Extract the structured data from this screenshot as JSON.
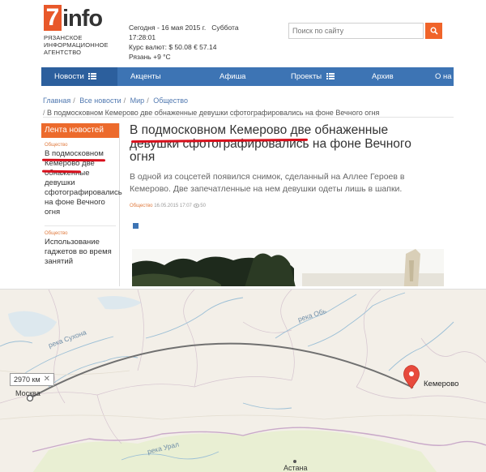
{
  "site": {
    "logo_digit": "7",
    "logo_word": "info",
    "agency_lines": [
      "РЯЗАНСКОЕ",
      "ИНФОРМАЦИОННОЕ",
      "АГЕНТСТВО"
    ],
    "date_line": "Сегодня - 16 мая 2015 г.   Суббота",
    "time_line": "17:28:01",
    "rates_line": "Курс валют: $ 50.08 € 57.14",
    "weather_line": "Рязань +9 °C",
    "search": {
      "placeholder": "Поиск по сайту",
      "icon": "search-icon"
    },
    "nav": [
      {
        "label": "Новости",
        "icon": "menu-bars-icon",
        "active": true
      },
      {
        "label": "Акценты"
      },
      {
        "label": "Афиша"
      },
      {
        "label": "Проекты",
        "icon": "menu-bars-icon"
      },
      {
        "label": "Архив"
      },
      {
        "label": "О на"
      }
    ],
    "breadcrumb": [
      "Главная",
      "Все новости",
      "Мир",
      "Общество"
    ],
    "breadcrumb_sep": "/",
    "breadcrumb_current": "В подмосковном Кемерово две обнаженные девушки сфотографировались на фоне Вечного огня",
    "feed": {
      "heading": "Лента новостей",
      "items": [
        {
          "category": "Общество",
          "title": "В подмосковном Кемерово две обнаженные девушки сфотографировались на фоне Вечного огня"
        },
        {
          "category": "Общество",
          "title": "Использование гаджетов во время занятий"
        }
      ]
    },
    "article": {
      "title": "В подмосковном Кемерово две обнаженные девушки сфотографировались на фоне Вечного огня",
      "lead": "В одной из соцсетей появился снимок, сделанный на Аллее Героев в Кемерово. Две запечатленные на нем девушки одеты лишь в шапки.",
      "category": "Общество",
      "date": "16.05.2015 17:07",
      "views": "50"
    },
    "highlight_color": "#d8101c",
    "accent_orange": "#ec6a2c",
    "nav_blue": "#3d74b4"
  },
  "map": {
    "distance": "2970 км",
    "close_icon": "close-icon",
    "pin_icon": "map-pin-icon",
    "cities": {
      "origin": "Москва",
      "destination": "Кемерово",
      "astana": "Астана"
    },
    "rivers": {
      "sukhona": "река Сухона",
      "ob": "река Обь",
      "ural": "река Урал"
    },
    "colors": {
      "land": "#f3efe8",
      "kazakhstan": "#eaf0d6",
      "route": "#707070",
      "pin": "#e74a3c",
      "border": "#c9a9c9"
    }
  }
}
